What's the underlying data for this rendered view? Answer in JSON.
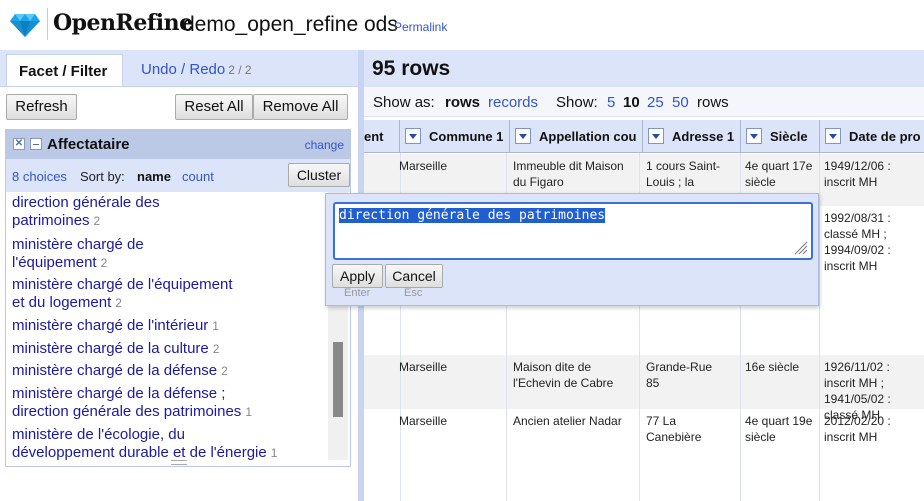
{
  "header": {
    "app_name": "OpenRefine",
    "project_name": "demo_open_refine ods",
    "permalink": "Permalink"
  },
  "left_tabs": {
    "facet_filter": "Facet / Filter",
    "undo_redo": "Undo / Redo",
    "undo_count": "2 / 2"
  },
  "toolbar": {
    "refresh": "Refresh",
    "reset_all": "Reset All",
    "remove_all": "Remove All"
  },
  "facet": {
    "title": "Affectataire",
    "change": "change",
    "choices": "8 choices",
    "sort_by": "Sort by:",
    "sort_name": "name",
    "sort_count": "count",
    "cluster": "Cluster",
    "items": [
      {
        "line1": "direction générale des",
        "line2": "patrimoines",
        "count": "2"
      },
      {
        "line1": "ministère chargé de",
        "line2": "l'équipement",
        "count": "2"
      },
      {
        "line1": "ministère chargé de l'équipement",
        "line2": "et du logement",
        "count": "2"
      },
      {
        "line1": "ministère chargé de l'intérieur",
        "line2": "",
        "count": "1"
      },
      {
        "line1": "ministère chargé de la culture",
        "line2": "",
        "count": "2"
      },
      {
        "line1": "ministère chargé de la défense",
        "line2": "",
        "count": "2"
      },
      {
        "line1": "ministère chargé de la défense ;",
        "line2": "direction générale des patrimoines",
        "count": "1"
      },
      {
        "line1": "ministère de l'écologie, du",
        "line2": "développement durable et de l'énergie",
        "count": "1"
      }
    ]
  },
  "grid": {
    "rows_count": "95 rows",
    "show_as": "Show as:",
    "rows": "rows",
    "records": "records",
    "show": "Show:",
    "page_sizes": [
      "5",
      "10",
      "25",
      "50"
    ],
    "rows_label": "rows",
    "columns": [
      "ent",
      "Commune 1",
      "Appellation cou",
      "Adresse 1",
      "Siècle",
      "Date de pro"
    ],
    "data": [
      {
        "commune": "Marseille",
        "appellation": "Immeuble dit Maison du Figaro",
        "adresse": "1 cours Saint-Louis ; la Canebière",
        "siecle": "4e quart 17e siècle",
        "date": "1949/12/06 : inscrit MH"
      },
      {
        "commune": "",
        "appellation": "",
        "adresse": "",
        "siecle": "",
        "date": "1992/08/31 : classé MH ; 1994/09/02 : inscrit MH"
      },
      {
        "commune": "Marseille",
        "appellation": "Maison dite de l'Echevin de Cabre",
        "adresse": "Grande-Rue 85",
        "siecle": "16e siècle",
        "date": "1926/11/02 : inscrit MH ; 1941/05/02 : classé MH"
      },
      {
        "commune": "Marseille",
        "appellation": "Ancien atelier Nadar",
        "adresse": "77 La Canebière",
        "siecle": "4e quart 19e siècle",
        "date": "2012/02/20 : inscrit MH"
      }
    ]
  },
  "edit_popup": {
    "value": "direction générale des patrimoines",
    "apply": "Apply",
    "cancel": "Cancel",
    "apply_hint": "Enter",
    "cancel_hint": "Esc"
  }
}
